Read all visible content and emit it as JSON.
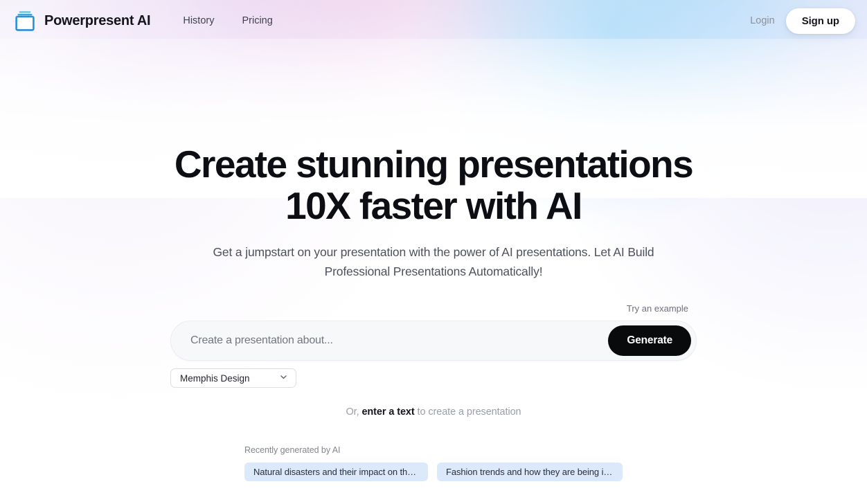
{
  "header": {
    "logo_icon": "stacked-slides-icon",
    "brand_name": "Powerpresent AI",
    "nav": [
      {
        "label": "History"
      },
      {
        "label": "Pricing"
      }
    ],
    "login_label": "Login",
    "signup_label": "Sign up"
  },
  "hero": {
    "headline_line1": "Create stunning presentations",
    "headline_line2": "10X faster with AI",
    "subhead_line1": "Get a jumpstart on your presentation with the power of AI presentations. Let AI Build",
    "subhead_line2": "Professional Presentations Automatically!"
  },
  "prompt": {
    "try_example_label": "Try an example",
    "input_value": "",
    "input_placeholder": "Create a presentation about...",
    "generate_label": "Generate",
    "style_selected": "Memphis Design",
    "chevron_icon": "chevron-down-icon",
    "or_prefix": "Or, ",
    "or_link": "enter a text",
    "or_suffix": " to create a presentation"
  },
  "recent": {
    "title": "Recently generated by AI",
    "chips": [
      {
        "label": "Natural disasters and their impact on the ..."
      },
      {
        "label": "Fashion trends and how they are being inf..."
      }
    ]
  },
  "colors": {
    "accent_logo": "#2b8fd8",
    "accent_logo_light": "#63c7e0",
    "generate_bg": "#090a0c",
    "chip_bg": "#dbe9fb",
    "text_primary": "#0c0e14",
    "text_muted": "#82868f"
  }
}
